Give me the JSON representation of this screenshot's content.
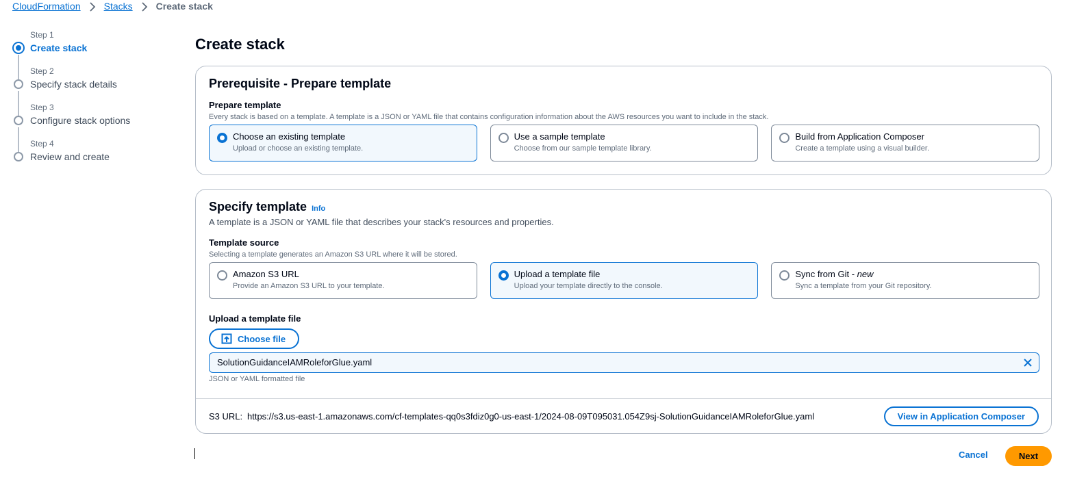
{
  "breadcrumb": {
    "items": [
      "CloudFormation",
      "Stacks"
    ],
    "current": "Create stack"
  },
  "steps": [
    {
      "number": "Step 1",
      "title": "Create stack",
      "active": true
    },
    {
      "number": "Step 2",
      "title": "Specify stack details",
      "active": false
    },
    {
      "number": "Step 3",
      "title": "Configure stack options",
      "active": false
    },
    {
      "number": "Step 4",
      "title": "Review and create",
      "active": false
    }
  ],
  "page_title": "Create stack",
  "prerequisite": {
    "heading": "Prerequisite - Prepare template",
    "field_label": "Prepare template",
    "field_description": "Every stack is based on a template. A template is a JSON or YAML file that contains configuration information about the AWS resources you want to include in the stack.",
    "options": [
      {
        "title": "Choose an existing template",
        "description": "Upload or choose an existing template.",
        "selected": true
      },
      {
        "title": "Use a sample template",
        "description": "Choose from our sample template library.",
        "selected": false
      },
      {
        "title": "Build from Application Composer",
        "description": "Create a template using a visual builder.",
        "selected": false
      }
    ]
  },
  "specify_template": {
    "heading": "Specify template",
    "info_link": "Info",
    "description": "A template is a JSON or YAML file that describes your stack's resources and properties.",
    "source_label": "Template source",
    "source_description": "Selecting a template generates an Amazon S3 URL where it will be stored.",
    "sources": [
      {
        "title": "Amazon S3 URL",
        "suffix": "",
        "description": "Provide an Amazon S3 URL to your template.",
        "selected": false
      },
      {
        "title": "Upload a template file",
        "suffix": "",
        "description": "Upload your template directly to the console.",
        "selected": true
      },
      {
        "title": "Sync from Git - ",
        "suffix": "new",
        "description": "Sync a template from your Git repository.",
        "selected": false
      }
    ],
    "upload_label": "Upload a template file",
    "choose_file_label": "Choose file",
    "file_name": "SolutionGuidanceIAMRoleforGlue.yaml",
    "file_hint": "JSON or YAML formatted file",
    "s3_url_label": "S3 URL:",
    "s3_url_value": "https://s3.us-east-1.amazonaws.com/cf-templates-qq0s3fdiz0g0-us-east-1/2024-08-09T095031.054Z9sj-SolutionGuidanceIAMRoleforGlue.yaml",
    "view_composer_label": "View in Application Composer"
  },
  "actions": {
    "cancel_label": "Cancel",
    "next_label": "Next"
  },
  "colors": {
    "accent": "#0972d3",
    "primary_button": "#ff9900",
    "selected_tile_bg": "#f2f8fd"
  }
}
